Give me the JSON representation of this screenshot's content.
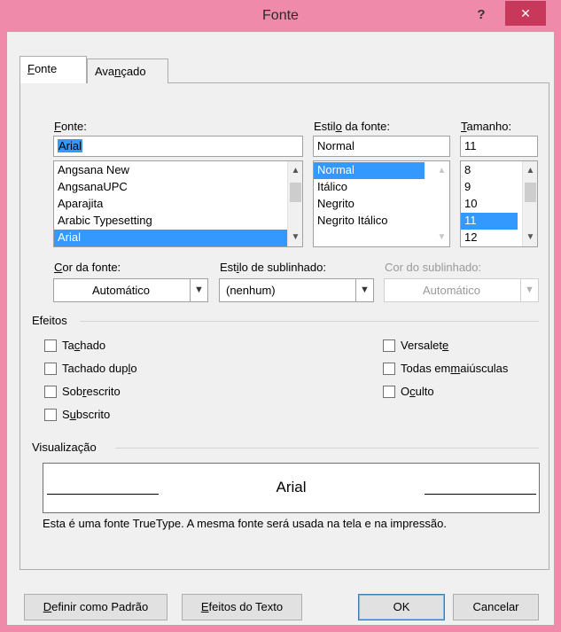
{
  "window": {
    "title": "Fonte",
    "help_label": "?",
    "close_label": "✕"
  },
  "tabs": [
    {
      "label_pre": "",
      "label_u": "F",
      "label_post": "onte"
    },
    {
      "label_pre": "Ava",
      "label_u": "n",
      "label_post": "çado"
    }
  ],
  "font": {
    "label_u": "F",
    "label_rest": "onte:",
    "value": "Arial",
    "items": [
      "Angsana New",
      "AngsanaUPC",
      "Aparajita",
      "Arabic Typesetting",
      "Arial"
    ]
  },
  "style": {
    "label_pre": "Estil",
    "label_u": "o",
    "label_post": " da fonte:",
    "value": "Normal",
    "items": [
      "Normal",
      "Itálico",
      "Negrito",
      "Negrito Itálico"
    ]
  },
  "size": {
    "label_pre": "",
    "label_u": "T",
    "label_post": "amanho:",
    "value": "11",
    "items": [
      "8",
      "9",
      "10",
      "11",
      "12"
    ]
  },
  "font_color": {
    "label_pre": "",
    "label_u": "C",
    "label_post": "or da fonte:",
    "value": "Automático"
  },
  "underline_style": {
    "label_pre": "Est",
    "label_u": "i",
    "label_post": "lo de sublinhado:",
    "value": "(nenhum)"
  },
  "underline_color": {
    "label": "Cor do sublinhado:",
    "value": "Automático"
  },
  "effects": {
    "heading": "Efeitos",
    "left": [
      {
        "pre": "Ta",
        "u": "c",
        "post": "hado"
      },
      {
        "pre": "Tachado dup",
        "u": "l",
        "post": "o"
      },
      {
        "pre": "Sob",
        "u": "r",
        "post": "escrito"
      },
      {
        "pre": "S",
        "u": "u",
        "post": "bscrito"
      }
    ],
    "right": [
      {
        "pre": "Versalet",
        "u": "e",
        "post": ""
      },
      {
        "pre": "Todas em ",
        "u": "m",
        "post": "aiúsculas"
      },
      {
        "pre": "O",
        "u": "c",
        "post": "ulto"
      }
    ]
  },
  "preview": {
    "heading": "Visualização",
    "sample": "Arial",
    "note": "Esta é uma fonte TrueType. A mesma fonte será usada na tela e na impressão."
  },
  "buttons": {
    "default": {
      "u": "D",
      "post": "efinir como Padrão"
    },
    "effects": {
      "u": "E",
      "post": "feitos do Texto"
    },
    "ok": "OK",
    "cancel": "Cancelar"
  }
}
